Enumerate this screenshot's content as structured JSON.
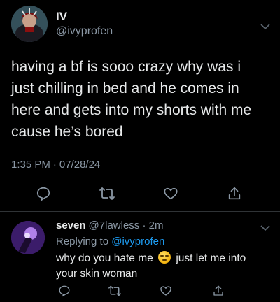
{
  "main_tweet": {
    "display_name": "IV",
    "handle": "@ivyprofen",
    "text": "having a bf is sooo crazy why was i\njust chilling in bed and he comes in\nhere and gets into my shorts with me\ncause he’s bored",
    "time": "1:35 PM",
    "separator": "·",
    "date": "07/28/24",
    "actions": [
      "reply-icon",
      "retweet-icon",
      "like-icon",
      "share-icon"
    ]
  },
  "reply": {
    "display_name": "seven",
    "handle": "@7lawless",
    "separator": "·",
    "time_ago": "2m",
    "replying_prefix": "Replying to",
    "replying_to": "@ivyprofen",
    "text_before_emoji": "why do you hate me",
    "emoji": "unamused-face-emoji",
    "text_after_emoji": "just let me into your skin woman"
  },
  "colors": {
    "background": "#000000",
    "primary_text": "#e7e9ea",
    "secondary_text": "#8b98a5",
    "link": "#1d9bf0",
    "divider": "#2f3336"
  }
}
